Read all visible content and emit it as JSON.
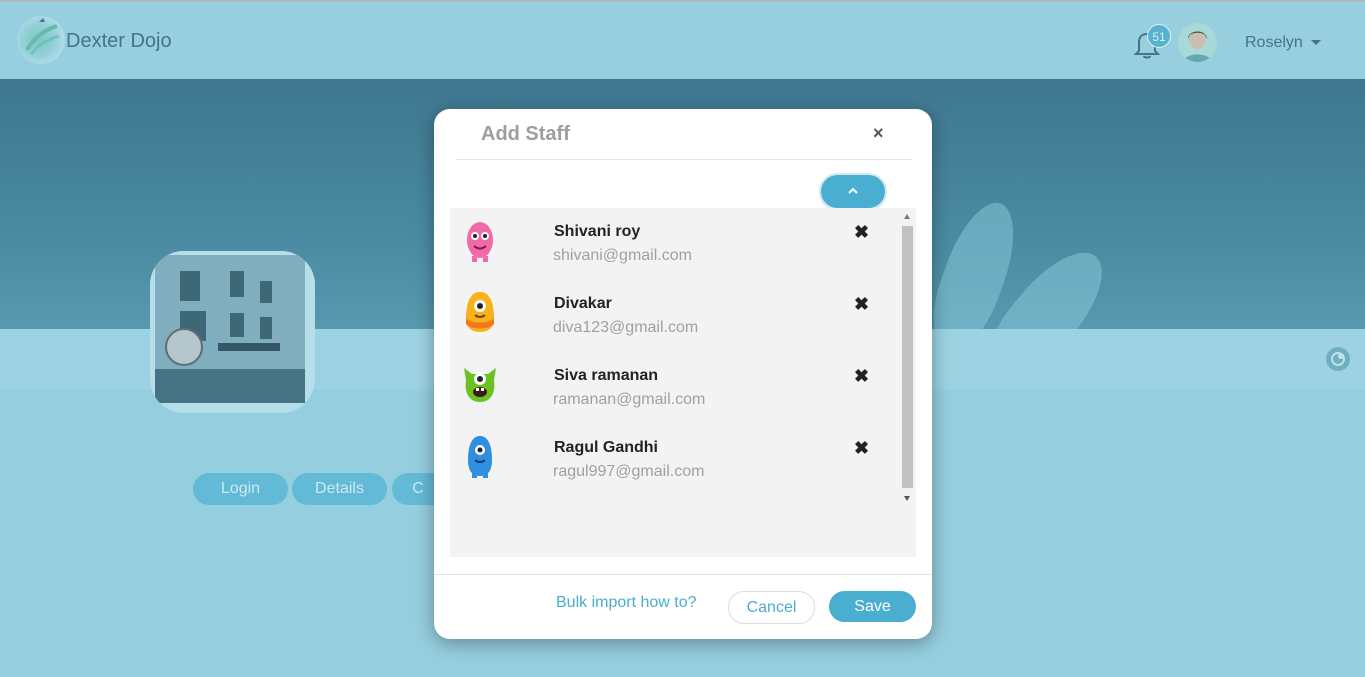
{
  "header": {
    "brand": "Dexter Dojo",
    "notifications_count": "51",
    "user_name": "Roselyn"
  },
  "background": {
    "tabs": [
      {
        "label": "Login"
      },
      {
        "label": "Details"
      },
      {
        "label": "C"
      }
    ]
  },
  "modal": {
    "title": "Add Staff",
    "close_label": "×",
    "remove_label": "✖",
    "staff": [
      {
        "name": "Shivani roy",
        "email": "shivani@gmail.com",
        "avatar": "pink-monster-icon"
      },
      {
        "name": "Divakar",
        "email": "diva123@gmail.com",
        "avatar": "yellow-monster-icon"
      },
      {
        "name": "Siva ramanan",
        "email": "ramanan@gmail.com",
        "avatar": "green-monster-icon"
      },
      {
        "name": "Ragul Gandhi",
        "email": "ragul997@gmail.com",
        "avatar": "blue-monster-icon"
      }
    ],
    "bulk_link": "Bulk import how to?",
    "cancel_label": "Cancel",
    "save_label": "Save"
  },
  "colors": {
    "accent": "#4aaed0",
    "header_bg": "#a3d5e3"
  }
}
